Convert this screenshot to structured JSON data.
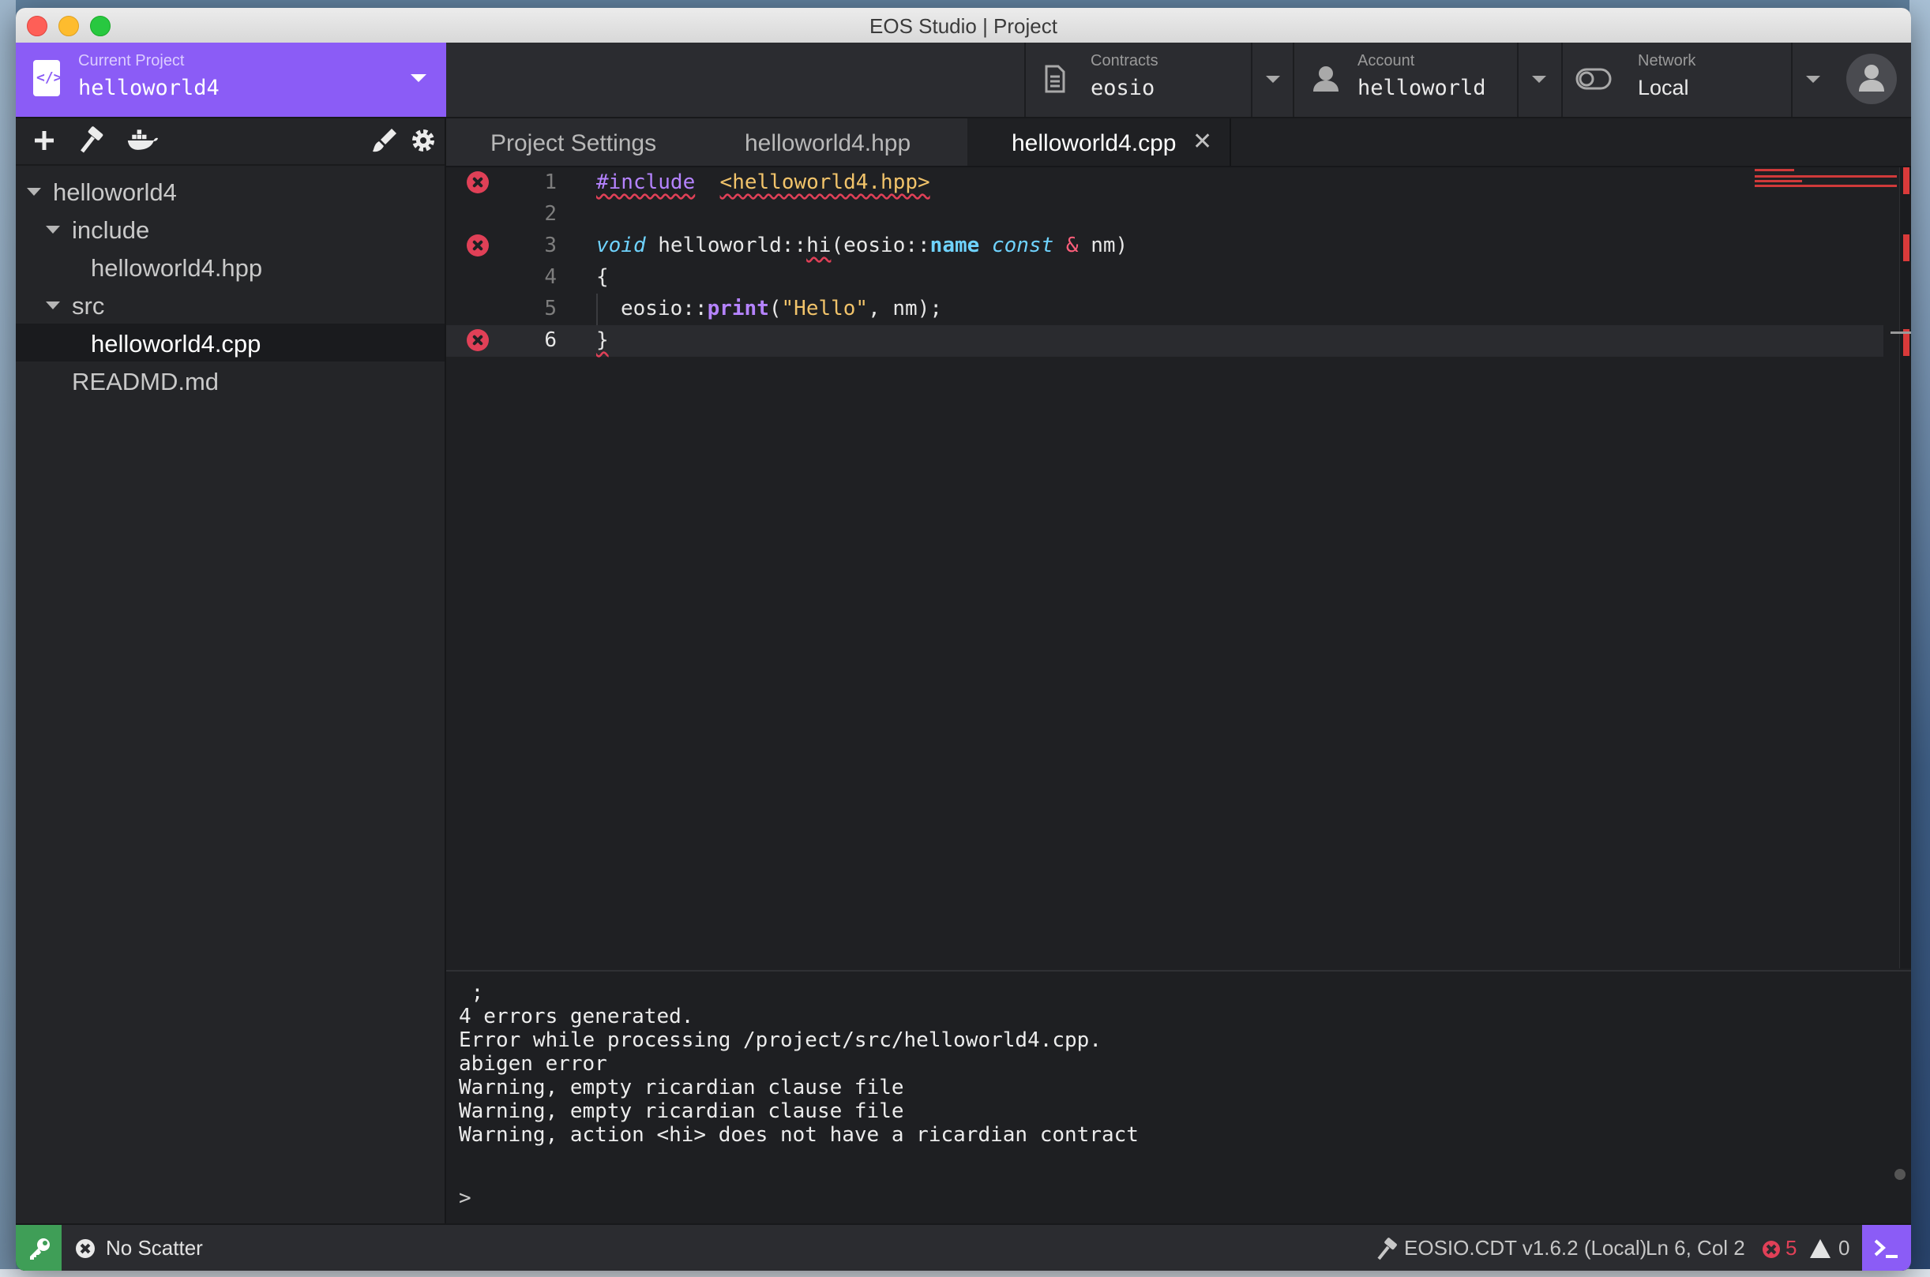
{
  "window": {
    "title": "EOS Studio | Project"
  },
  "header": {
    "project": {
      "caption": "Current Project",
      "name": "helloworld4"
    },
    "contracts": {
      "caption": "Contracts",
      "value": "eosio"
    },
    "account": {
      "caption": "Account",
      "value": "helloworld"
    },
    "network": {
      "caption": "Network",
      "value": "Local"
    }
  },
  "sidebar": {
    "tree": [
      {
        "label": "helloworld4"
      },
      {
        "label": "include"
      },
      {
        "label": "helloworld4.hpp"
      },
      {
        "label": "src"
      },
      {
        "label": "helloworld4.cpp"
      },
      {
        "label": "READMD.md"
      }
    ]
  },
  "tabs": [
    {
      "label": "Project Settings"
    },
    {
      "label": "helloworld4.hpp"
    },
    {
      "label": "helloworld4.cpp",
      "close": "✕"
    }
  ],
  "editor": {
    "line_numbers": [
      "1",
      "2",
      "3",
      "4",
      "5",
      "6"
    ],
    "tokens": {
      "l1_include": "#include",
      "l1_file": "<helloworld4.hpp>",
      "l3_void": "void",
      "l3_scope": " helloworld::",
      "l3_hi": "hi",
      "l3_open": "(eosio::",
      "l3_name": "name",
      "l3_const": "const",
      "l3_amp": "&",
      "l3_rest": " nm)",
      "l4_brace": "{",
      "l5_ns": "eosio::",
      "l5_print": "print",
      "l5_open": "(",
      "l5_str": "\"Hello\"",
      "l5_rest": ", nm);",
      "l6_brace": "}"
    },
    "error_lines": [
      "1",
      "3",
      "6"
    ],
    "current_line": "6"
  },
  "output": {
    "lines": [
      " ;",
      "4 errors generated.",
      "Error while processing /project/src/helloworld4.cpp.",
      "abigen error",
      "Warning, empty ricardian clause file",
      "Warning, empty ricardian clause file",
      "Warning, action <hi> does not have a ricardian contract"
    ],
    "prompt": ">"
  },
  "status": {
    "scatter": "No Scatter",
    "compiler": "EOSIO.CDT v1.6.2 (Local)",
    "cursor": "Ln 6, Col 2",
    "errors": "5",
    "warnings": "0"
  },
  "colors": {
    "accent": "#8b5cf6",
    "error": "#e04057",
    "success": "#3f9e57"
  }
}
